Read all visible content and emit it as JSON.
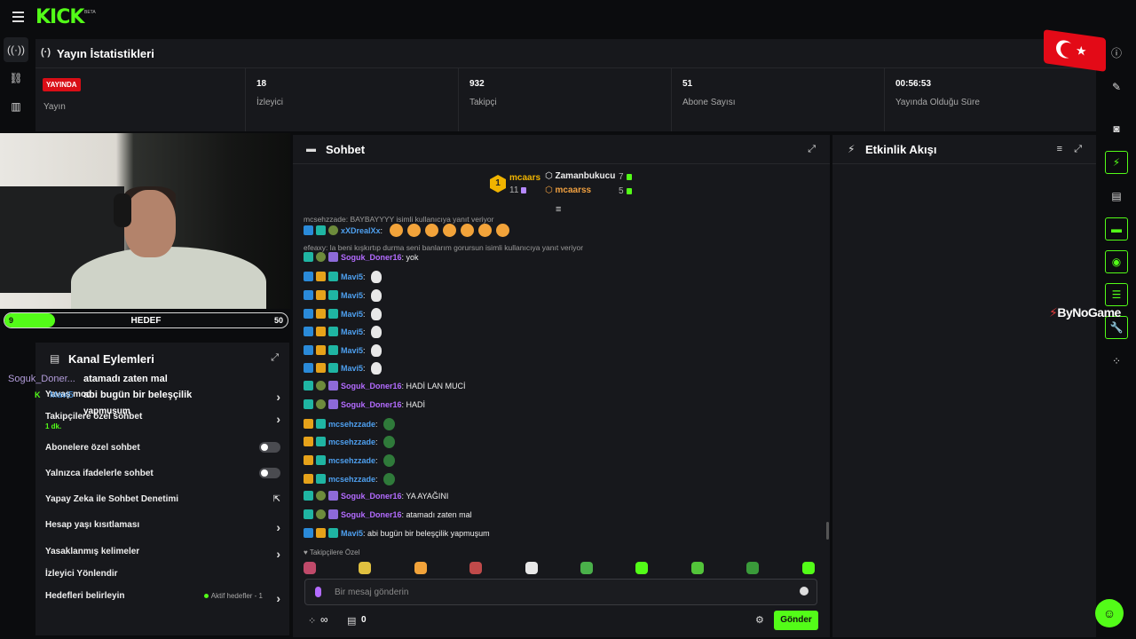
{
  "app": {
    "logo": "KICK",
    "logo_badge": "BETA"
  },
  "left_rail": {
    "icons": [
      "broadcast-icon",
      "link-icon",
      "chart-icon"
    ]
  },
  "stats": {
    "title": "Yayın İstatistikleri",
    "items": [
      {
        "value": "YAYINDA",
        "label": "Yayın"
      },
      {
        "value": "18",
        "label": "İzleyici"
      },
      {
        "value": "932",
        "label": "Takipçi"
      },
      {
        "value": "51",
        "label": "Abone Sayısı"
      },
      {
        "value": "00:56:53",
        "label": "Yayında Olduğu Süre"
      }
    ]
  },
  "goal": {
    "current": 9,
    "label": "HEDEF",
    "target": 50,
    "progress": 0.18
  },
  "overlay": {
    "name": "Soguk_Doner...",
    "msg1": "atamadı zaten mal",
    "k": "K",
    "name2": "Mavi5",
    "msg2": "abi bugün bir beleşçilik",
    "msg3": "yapmuşum"
  },
  "channel_actions": {
    "title": "Kanal Eylemleri",
    "rows": [
      {
        "label": "Yavaş mod"
      },
      {
        "label": "Takipçilere özel sohbet",
        "sub": "1 dk."
      },
      {
        "label": "Abonelere özel sohbet",
        "toggle": "off"
      },
      {
        "label": "Yalnızca ifadelerle sohbet",
        "toggle": "off"
      },
      {
        "label": "Yapay Zeka ile Sohbet Denetimi"
      },
      {
        "label": "Hesap yaşı kısıtlaması"
      },
      {
        "label": "Yasaklanmış kelimeler"
      },
      {
        "label": "İzleyici Yönlendir"
      },
      {
        "label": "Hedefleri belirleyin",
        "status": "Aktif hedefler - 1"
      }
    ]
  },
  "chat": {
    "title": "Sohbet",
    "leaderboard": [
      {
        "rank": "1",
        "name": "mcaars",
        "count": "11"
      },
      {
        "name": "Zamanbukucu",
        "count": "7"
      },
      {
        "name": "mcaarss",
        "count": "5"
      }
    ],
    "messages": [
      {
        "type": "reply",
        "text": "mcsehzzade: BAYBAYYYY isimli kullanıcıya yanıt veriyor"
      },
      {
        "user": "xXDrealXx",
        "color": "#4ea0f0",
        "text": "",
        "emotes": 7
      },
      {
        "type": "reply",
        "text": "efeaxy: la beni kışkırtıp durma seni banlarım gorursun isimli kullanıcıya yanıt veriyor"
      },
      {
        "user": "Soguk_Doner16",
        "color": "#b36bff",
        "text": "yok"
      },
      {
        "user": "Mavi5",
        "color": "#4ea0f0",
        "text": "",
        "duck": true
      },
      {
        "user": "Mavi5",
        "color": "#4ea0f0",
        "text": "",
        "duck": true
      },
      {
        "user": "Mavi5",
        "color": "#4ea0f0",
        "text": "",
        "duck": true
      },
      {
        "user": "Mavi5",
        "color": "#4ea0f0",
        "text": "",
        "duck": true
      },
      {
        "user": "Mavi5",
        "color": "#4ea0f0",
        "text": "",
        "duck": true
      },
      {
        "user": "Mavi5",
        "color": "#4ea0f0",
        "text": "",
        "duck": true
      },
      {
        "user": "Soguk_Doner16",
        "color": "#b36bff",
        "text": "HADİ LAN MUCİ"
      },
      {
        "user": "Soguk_Doner16",
        "color": "#b36bff",
        "text": "HADİ"
      },
      {
        "user": "mcsehzzade",
        "color": "#4ea0f0",
        "text": "",
        "frog": true
      },
      {
        "user": "mcsehzzade",
        "color": "#4ea0f0",
        "text": "",
        "frog": true
      },
      {
        "user": "mcsehzzade",
        "color": "#4ea0f0",
        "text": "",
        "frog": true
      },
      {
        "user": "mcsehzzade",
        "color": "#4ea0f0",
        "text": "",
        "frog": true
      },
      {
        "user": "Soguk_Doner16",
        "color": "#b36bff",
        "text": "YA AYAĞINI"
      },
      {
        "user": "Soguk_Doner16",
        "color": "#b36bff",
        "text": "atamadı zaten mal"
      },
      {
        "user": "Mavi5",
        "color": "#4ea0f0",
        "text": "abi bugün bir beleşçilik yapmuşum"
      }
    ],
    "followers_label": "Takipçilere Özel",
    "input_placeholder": "Bir mesaj gönderin",
    "footer_infinity": "∞",
    "footer_count": "0",
    "send_label": "Gönder"
  },
  "activity": {
    "title": "Etkinlik Akışı"
  },
  "watermark": {
    "text": "ByNoGame"
  }
}
